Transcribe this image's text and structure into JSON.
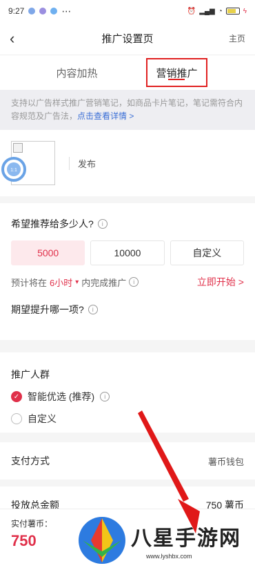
{
  "status_bar": {
    "time": "9:27",
    "battery": "88"
  },
  "nav": {
    "back_glyph": "‹",
    "title": "推广设置页",
    "home": "主页"
  },
  "tabs": [
    {
      "label": "内容加热"
    },
    {
      "label": "营销推广"
    }
  ],
  "notice": {
    "text": "支持以广告样式推广营销笔记，如商品卡片笔记，笔记需符合内容规范及广告法，",
    "link": "点击查看详情 >"
  },
  "publish": {
    "label": "发布",
    "float_text": "1:1"
  },
  "reach": {
    "title": "希望推荐给多少人?",
    "options": [
      {
        "label": "5000"
      },
      {
        "label": "10000"
      },
      {
        "label": "自定义"
      }
    ],
    "estimate_prefix": "预计将在",
    "estimate_highlight": "6小时",
    "estimate_suffix": "内完成推广",
    "start_label": "立即开始 >",
    "boost_title": "期望提升哪一项?"
  },
  "audience": {
    "title": "推广人群",
    "smart": "智能优选 (推荐)",
    "custom": "自定义"
  },
  "payment": {
    "label": "支付方式",
    "value": "薯币钱包"
  },
  "total": {
    "label": "投放总金额",
    "value": "750 薯币"
  },
  "bottom": {
    "label": "实付薯币：",
    "amount": "750"
  },
  "watermark": {
    "text": "八星手游网",
    "url": "www.lyshbx.com"
  },
  "colors": {
    "accent": "#e0304a",
    "link": "#3b6fd6"
  }
}
